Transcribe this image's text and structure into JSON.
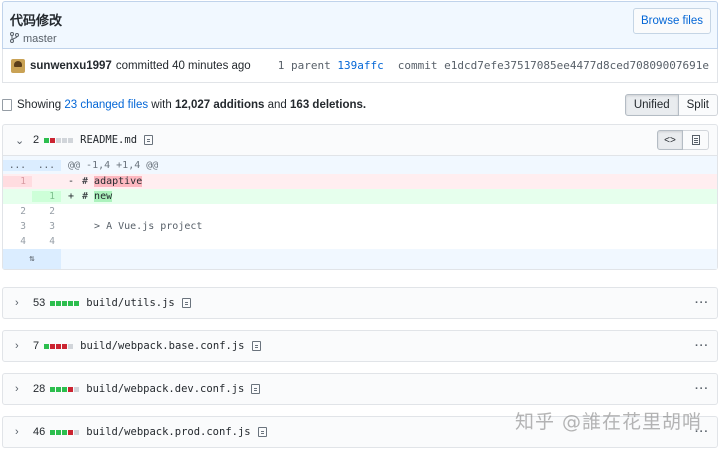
{
  "commit": {
    "title": "代码修改",
    "branch": "master",
    "browse_label": "Browse files",
    "author": "sunwenxu1997",
    "time_text": "committed 40 minutes ago",
    "parent_label": "1 parent",
    "parent_sha": "139affc",
    "commit_label": "commit",
    "commit_sha": "e1dcd7efe37517085ee4477d8ced70809007691e"
  },
  "summary": {
    "showing": "Showing",
    "changed_files": "23 changed files",
    "with": "with",
    "additions": "12,027 additions",
    "and": "and",
    "deletions": "163 deletions."
  },
  "view_toggle": {
    "unified": "Unified",
    "split": "Split"
  },
  "expanded_file": {
    "stat": "2",
    "diffstat": [
      "add",
      "del",
      "neu",
      "neu",
      "neu"
    ],
    "name": "README.md",
    "hunk_left": "...",
    "hunk_right": "...",
    "hunk_text": "@@ -1,4 +1,4 @@",
    "lines": [
      {
        "type": "del",
        "old": "1",
        "new": "",
        "marker": "-",
        "prefix": "# ",
        "highlight": "adaptive",
        "rest": ""
      },
      {
        "type": "add",
        "old": "",
        "new": "1",
        "marker": "+",
        "prefix": "# ",
        "highlight": "new",
        "rest": ""
      },
      {
        "type": "ctx",
        "old": "2",
        "new": "2",
        "marker": "",
        "prefix": "",
        "highlight": "",
        "rest": ""
      },
      {
        "type": "ctx",
        "old": "3",
        "new": "3",
        "marker": "",
        "prefix": "  > A Vue.js project",
        "highlight": "",
        "rest": ""
      },
      {
        "type": "ctx",
        "old": "4",
        "new": "4",
        "marker": "",
        "prefix": "",
        "highlight": "",
        "rest": ""
      }
    ],
    "expand_glyph": "⇅"
  },
  "collapsed_files": [
    {
      "stat": "53",
      "diffstat": [
        "add",
        "add",
        "add",
        "add",
        "add"
      ],
      "name": "build/utils.js"
    },
    {
      "stat": "7",
      "diffstat": [
        "add",
        "del",
        "del",
        "del",
        "neu"
      ],
      "name": "build/webpack.base.conf.js"
    },
    {
      "stat": "28",
      "diffstat": [
        "add",
        "add",
        "add",
        "del",
        "neu"
      ],
      "name": "build/webpack.dev.conf.js"
    },
    {
      "stat": "46",
      "diffstat": [
        "add",
        "add",
        "add",
        "del",
        "neu"
      ],
      "name": "build/webpack.prod.conf.js"
    }
  ],
  "more_glyph": "···",
  "watermark": "知乎 @誰在花里胡哨",
  "colors": {
    "add": "#2cbe4e",
    "del": "#cb2431",
    "neutral": "#d1d5da",
    "link": "#0366d6"
  }
}
